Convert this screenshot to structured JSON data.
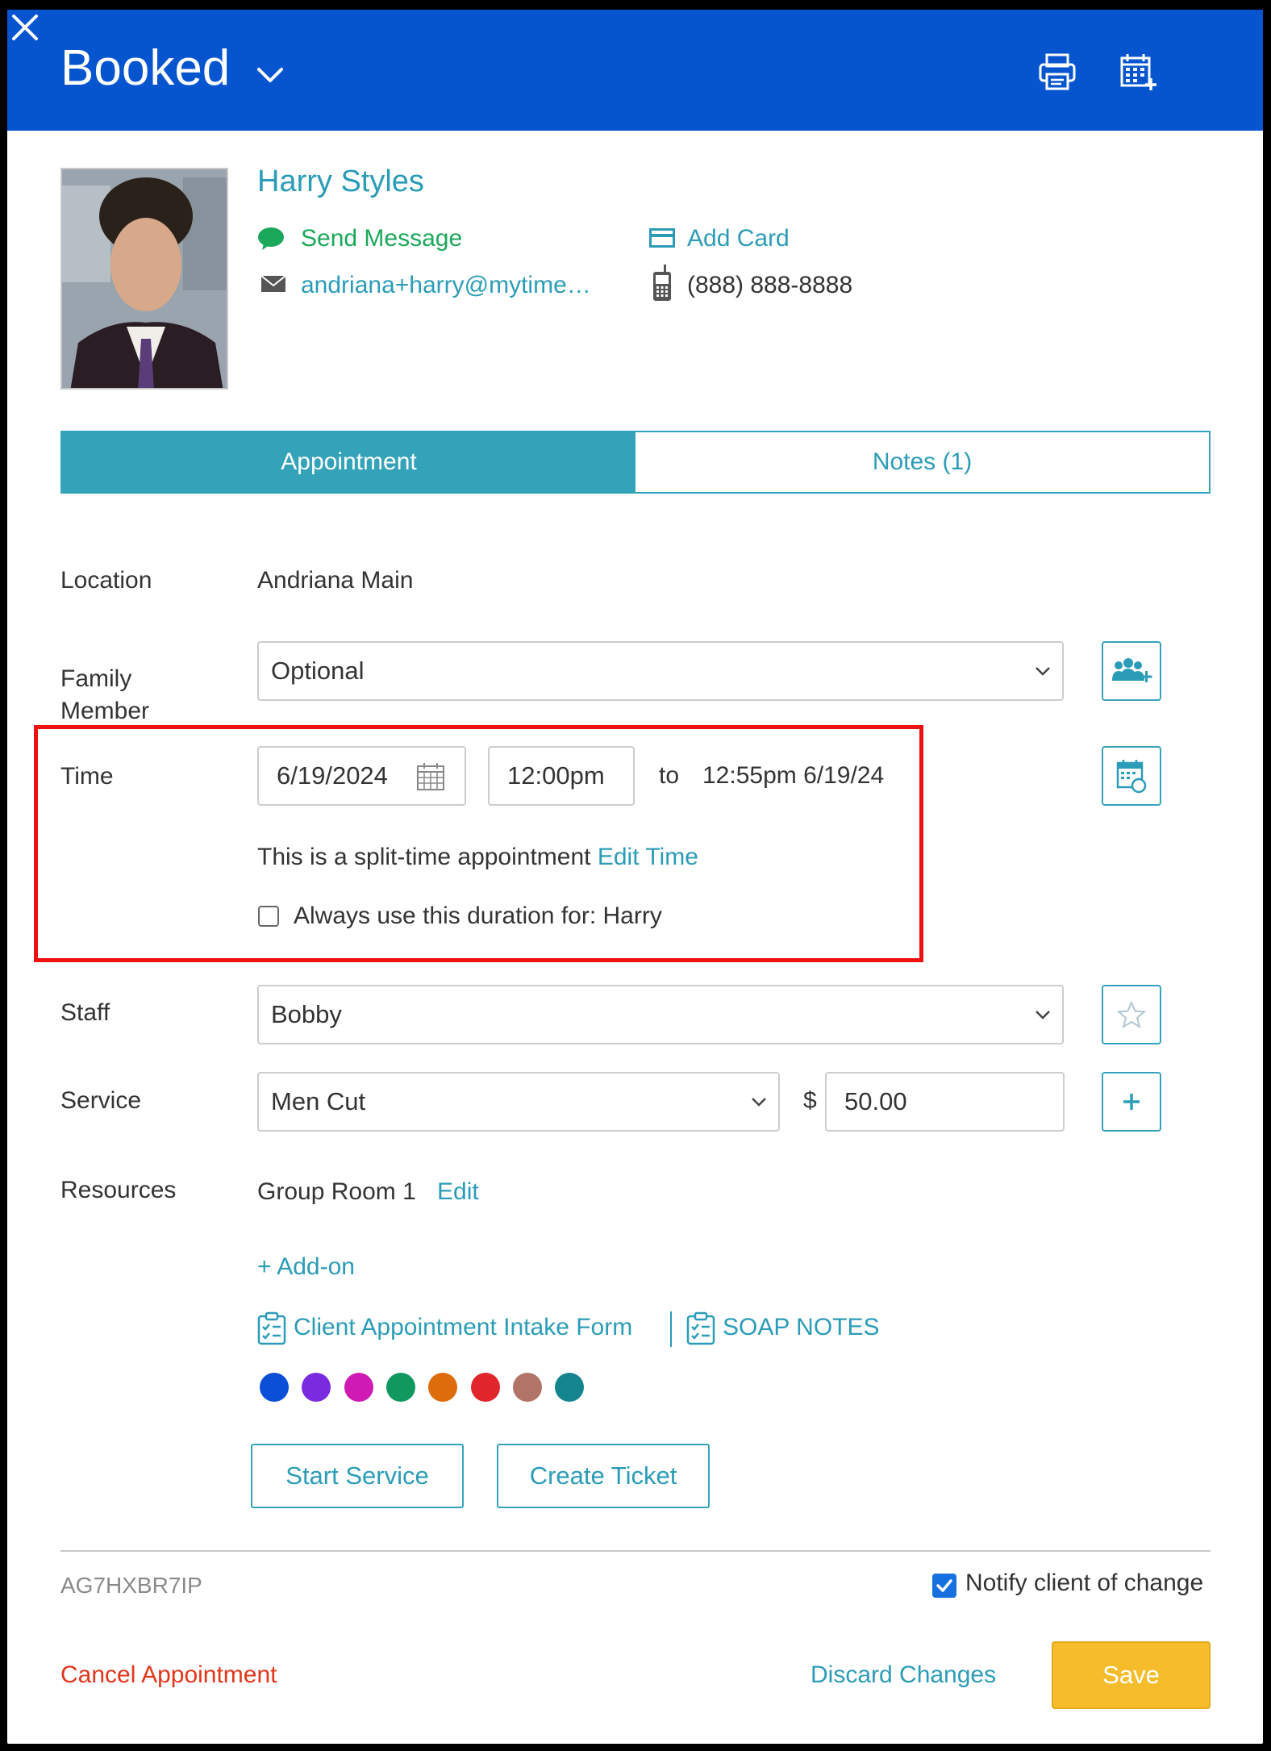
{
  "header": {
    "status": "Booked"
  },
  "client": {
    "name": "Harry Styles",
    "send_message": "Send Message",
    "email": "andriana+harry@mytime.com",
    "add_card": "Add Card",
    "phone": "(888) 888-8888"
  },
  "tabs": [
    {
      "label": "Appointment",
      "active": true
    },
    {
      "label": "Notes (1)",
      "active": false
    }
  ],
  "form": {
    "location_label": "Location",
    "location_value": "Andriana Main",
    "family_label": "Family Member",
    "family_value": "Optional",
    "time_label": "Time",
    "date_value": "6/19/2024",
    "start_time": "12:00pm",
    "to_text": "to",
    "end_time": "12:55pm 6/19/24",
    "split_text": "This is a split-time appointment",
    "edit_time": "Edit Time",
    "duration_label": "Always use this duration for: Harry",
    "staff_label": "Staff",
    "staff_value": "Bobby",
    "service_label": "Service",
    "service_value": "Men Cut",
    "currency": "$",
    "price": "50.00",
    "resources_label": "Resources",
    "resources_value": "Group Room 1",
    "resources_edit": "Edit",
    "add_on": "+ Add-on",
    "intake_form": "Client Appointment Intake Form",
    "soap_notes": "SOAP NOTES"
  },
  "colors": [
    "#0a4fd6",
    "#7a2be0",
    "#cf1bb3",
    "#10985e",
    "#dd6c0c",
    "#e0262b",
    "#b27466",
    "#14858f"
  ],
  "actions": {
    "start_service": "Start Service",
    "create_ticket": "Create Ticket",
    "booking_code": "AG7HXBR7IP",
    "notify": "Notify client of change",
    "cancel": "Cancel Appointment",
    "discard": "Discard Changes",
    "save": "Save"
  }
}
